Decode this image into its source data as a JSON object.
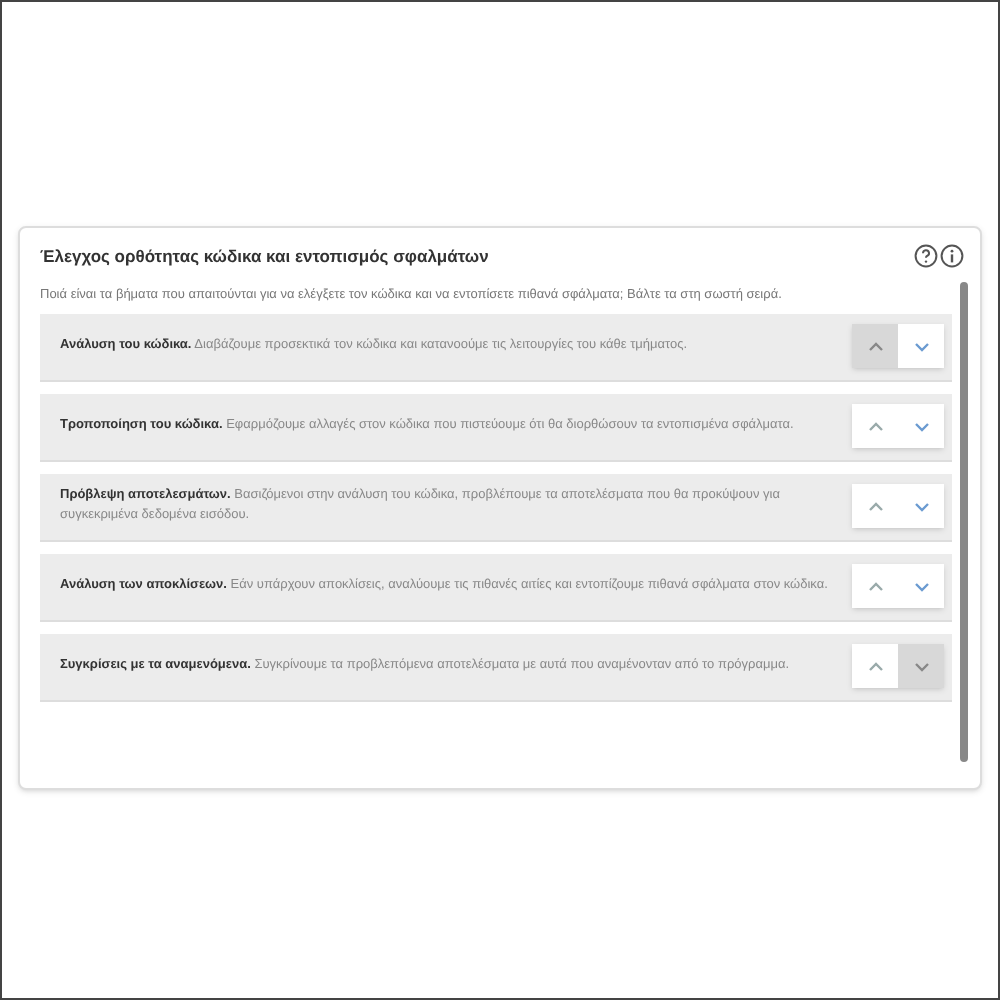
{
  "title": "Έλεγχος ορθότητας κώδικα και εντοπισμός σφαλμάτων",
  "prompt": "Ποιά είναι τα βήματα που απαιτούνται για να ελέγξετε τον κώδικα και να εντοπίσετε πιθανά σφάλματα; Βάλτε τα στη σωστή σειρά.",
  "items": [
    {
      "text": "**Ανάλυση του κώδικα.** Διαβάζουμε προσεκτικά τον κώδικα και κατανοούμε τις λειτουργίες του κάθε τμήματος.",
      "up_disabled": true,
      "down_disabled": false
    },
    {
      "text": "**Τροποποίηση του κώδικα.** Εφαρμόζουμε αλλαγές στον κώδικα που πιστεύουμε ότι θα διορθώσουν τα εντοπισμένα σφάλματα.",
      "up_disabled": false,
      "down_disabled": false
    },
    {
      "text": "**Πρόβλεψη αποτελεσμάτων.** Βασιζόμενοι στην ανάλυση του κώδικα, προβλέπουμε τα αποτελέσματα που θα προκύψουν για συγκεκριμένα δεδομένα εισόδου.",
      "up_disabled": false,
      "down_disabled": false
    },
    {
      "text": "**Ανάλυση των αποκλίσεων.** Εάν υπάρχουν αποκλίσεις, αναλύουμε τις πιθανές αιτίες και εντοπίζουμε πιθανά σφάλματα στον κώδικα.",
      "up_disabled": false,
      "down_disabled": false
    },
    {
      "text": "**Συγκρίσεις με τα αναμενόμενα.** Συγκρίνουμε τα προβλεπόμενα αποτελέσματα με αυτά που αναμένονταν από το πρόγραμμα.",
      "up_disabled": false,
      "down_disabled": true
    }
  ]
}
